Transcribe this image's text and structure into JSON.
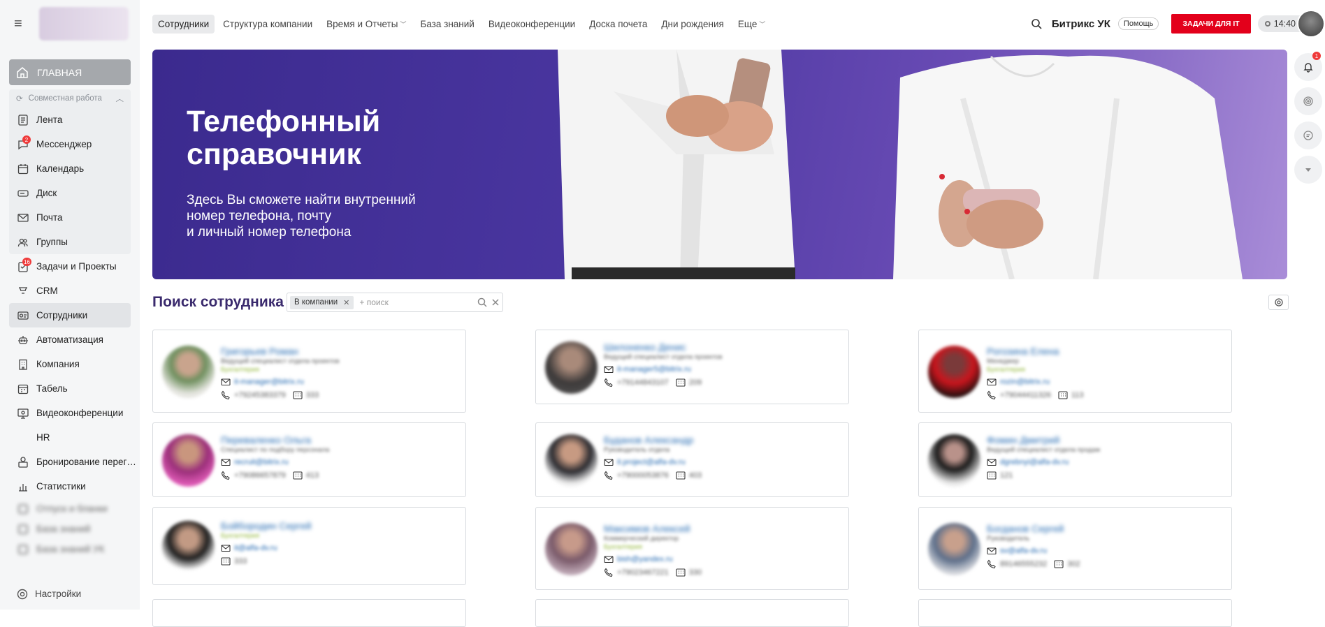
{
  "sidebar": {
    "home_label": "ГЛАВНАЯ",
    "group_label": "Совместная работа",
    "items": [
      {
        "label": "Лента",
        "icon": "feed-icon"
      },
      {
        "label": "Мессенджер",
        "icon": "messenger-icon",
        "badge": "2"
      },
      {
        "label": "Календарь",
        "icon": "calendar-icon"
      },
      {
        "label": "Диск",
        "icon": "disk-icon"
      },
      {
        "label": "Почта",
        "icon": "mail-icon"
      },
      {
        "label": "Группы",
        "icon": "groups-icon"
      }
    ],
    "items2": [
      {
        "label": "Задачи и Проекты",
        "icon": "tasks-icon",
        "badge": "16"
      },
      {
        "label": "CRM",
        "icon": "crm-icon"
      },
      {
        "label": "Сотрудники",
        "icon": "employees-icon"
      },
      {
        "label": "Автоматизация",
        "icon": "automation-icon"
      },
      {
        "label": "Компания",
        "icon": "company-icon"
      },
      {
        "label": "Табель",
        "icon": "timesheet-icon"
      },
      {
        "label": "Видеоконференции",
        "icon": "video-icon"
      },
      {
        "label": "HR",
        "icon": ""
      },
      {
        "label": "Бронирование перег…",
        "icon": "booking-icon"
      },
      {
        "label": "Статистики",
        "icon": "stats-icon"
      }
    ],
    "blurred": [
      "Отпуск и бланки",
      "База знаний",
      "База знаний УК"
    ],
    "settings_label": "Настройки"
  },
  "topbar": {
    "tabs": [
      {
        "label": "Сотрудники",
        "active": true
      },
      {
        "label": "Структура компании"
      },
      {
        "label": "Время и Отчеты",
        "dropdown": true
      },
      {
        "label": "База знаний"
      },
      {
        "label": "Видеоконференции"
      },
      {
        "label": "Доска почета"
      },
      {
        "label": "Дни рождения"
      },
      {
        "label": "Еще",
        "dropdown": true
      }
    ],
    "company": "Битрикс УК",
    "help": "Помощь",
    "tasks_button": "ЗАДАЧИ ДЛЯ IT",
    "time": "14:40"
  },
  "rightbar": {
    "notifications_badge": "1"
  },
  "banner": {
    "title_line1": "Телефонный",
    "title_line2": "справочник",
    "sub_line1": "Здесь Вы сможете найти внутренний",
    "sub_line2": "номер телефона, почту",
    "sub_line3": "и личный номер телефона"
  },
  "search": {
    "title": "Поиск сотрудника",
    "chip": "В компании",
    "placeholder": "+ поиск"
  },
  "employees": [
    {
      "name": "Григорьев Роман",
      "position": "Ведущий специалист отдела проектов",
      "dept": "Бухгалтерия",
      "email": "it-manager@bitrix.ru",
      "phone": "+79245383379",
      "ext": "333"
    },
    {
      "name": "Шилоненко Денис",
      "position": "Ведущий специалист отдела проектов",
      "dept": "",
      "email": "it-manager5@bitrix.ru",
      "phone": "+79144843107",
      "ext": "209"
    },
    {
      "name": "Рогозина Елена",
      "position": "Менеджер",
      "dept": "Бухгалтерия",
      "email": "rozin@bitrix.ru",
      "phone": "+79044411326",
      "ext": "113"
    },
    {
      "name": "Переваленко Ольга",
      "position": "Специалист по подбору персонала",
      "dept": "",
      "email": "recruit@bitrix.ru",
      "phone": "+79086657879",
      "ext": "413"
    },
    {
      "name": "Буданов Александр",
      "position": "Руководитель отдела",
      "dept": "",
      "email": "it.project@alfa-dv.ru",
      "phone": "+79000053876",
      "ext": "403"
    },
    {
      "name": "Фомин Дмитрий",
      "position": "Ведущий специалист отдела продаж",
      "dept": "",
      "email": "dgrebnyi@alfa-dv.ru",
      "phone": "",
      "ext": "121"
    },
    {
      "name": "Бойбородин Сергей",
      "position": "",
      "dept": "Бухгалтерия",
      "email": "it@alfa-dv.ru",
      "phone": "",
      "ext": "333"
    },
    {
      "name": "Максимов Алексей",
      "position": "Коммерческий директор",
      "dept": "Бухгалтерия",
      "email": "bish@yandex.ru",
      "phone": "+79023467221",
      "ext": "330"
    },
    {
      "name": "Богданов Сергей",
      "position": "Руководитель",
      "dept": "",
      "email": "sv@alfa-dv.ru",
      "phone": "89146555232",
      "ext": "302"
    }
  ],
  "colors": {
    "accent": "#e3001b",
    "link": "#2067b0",
    "banner": "#4a36a0",
    "title": "#3a2a6d"
  }
}
